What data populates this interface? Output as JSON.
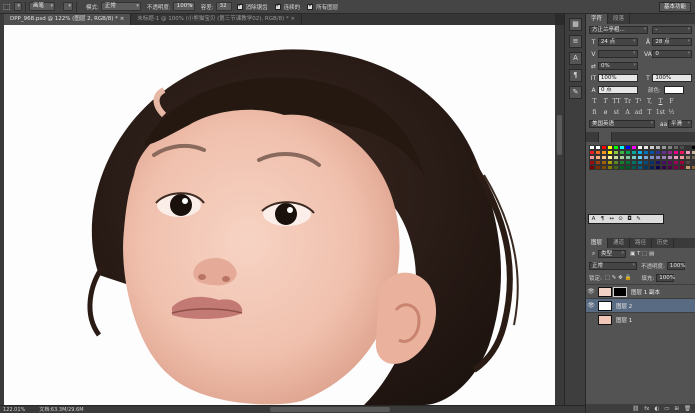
{
  "options_bar": {
    "tool_icon": "marquee-icon",
    "blend_mode_label": "模式:",
    "brush_dropdown": "画笔",
    "mode_value": "正常",
    "opacity_label": "不透明度:",
    "opacity_value": "100%",
    "tolerance_label": "容差:",
    "tolerance_value": "32",
    "anti_alias_label": "消除锯齿",
    "contiguous_label": "连续的",
    "all_layers_label": "所有图层",
    "workspace_button": "基本功能"
  },
  "tabs": [
    {
      "label": "DPP_968.psd @ 122% (图层 2, RGB/8) *",
      "active": true
    },
    {
      "label": "未标题-1 @ 100% (小熊猫宝贝 (第三节课教学02), RGB/8) *",
      "active": false
    }
  ],
  "status": {
    "zoom": "122.01%",
    "doc_size": "文档:63.3M/29.6M"
  },
  "character_panel": {
    "tabs": [
      "字符",
      "段落"
    ],
    "font_family": "方正兰亭粗...",
    "font_style": "-",
    "font_size": "24 点",
    "leading": "28 点",
    "kerning": "",
    "tracking": "0",
    "tsume": "0%",
    "vertical_scale": "100%",
    "horizontal_scale": "100%",
    "baseline_shift": "0 点",
    "color_label": "颜色:",
    "language": "美国英语",
    "antialias": "平滑"
  },
  "type_glyphs": [
    "T",
    "T",
    "TT",
    "Tr",
    "T¹",
    "T,",
    "T",
    "F"
  ],
  "ot_glyphs": [
    "fi",
    "ø",
    "st",
    "A",
    "ad",
    "T",
    "1st",
    "½"
  ],
  "swatch_colors": [
    "#ffffff",
    "#ffffff",
    "#ff0000",
    "#ffff00",
    "#00ff00",
    "#00ffff",
    "#0000ff",
    "#ff00ff",
    "#ffffff",
    "#e6e6e6",
    "#cccccc",
    "#b3b3b3",
    "#999999",
    "#808080",
    "#666666",
    "#4d4d4d",
    "#333333",
    "#000000",
    "#ed1c24",
    "#f26522",
    "#f7941d",
    "#fff200",
    "#8dc63f",
    "#39b54a",
    "#00a651",
    "#00a99d",
    "#00aeef",
    "#0072bc",
    "#0054a6",
    "#2e3192",
    "#662d91",
    "#92278f",
    "#ec008c",
    "#ed145b",
    "#f49ac2",
    "#c7b299",
    "#f6989d",
    "#f9ad81",
    "#fdc68a",
    "#fff79a",
    "#c4df9b",
    "#a3d39c",
    "#82ca9d",
    "#7accc8",
    "#6dcff6",
    "#7da7d9",
    "#8393ca",
    "#8781bd",
    "#a186be",
    "#bd8cbf",
    "#f49ac1",
    "#f5989d",
    "#998675",
    "#736357",
    "#9e0b0f",
    "#a0410d",
    "#a36209",
    "#aba000",
    "#598527",
    "#1a7b30",
    "#007236",
    "#00746b",
    "#0076a3",
    "#004b80",
    "#003471",
    "#1b1464",
    "#440e62",
    "#630460",
    "#9e005d",
    "#9e0039",
    "#534741",
    "#362f2d",
    "#790000",
    "#7b2e00",
    "#7d4900",
    "#827b00",
    "#406618",
    "#005e20",
    "#005826",
    "#005952",
    "#005b7f",
    "#003663",
    "#002157",
    "#0d004c",
    "#32004b",
    "#4b0049",
    "#7b0046",
    "#7a0026",
    "#c69c6d",
    "#8c6239"
  ],
  "tool_strip": [
    "A-icon",
    "paragraph-icon",
    "move-icon",
    "wand-icon",
    "camera-icon",
    "wrench-icon"
  ],
  "layers_panel": {
    "tabs": [
      "图层",
      "通道",
      "路径",
      "历史"
    ],
    "filter_label": "类型",
    "blend_mode": "正常",
    "opacity_label": "不透明度:",
    "opacity_value": "100%",
    "lock_label": "锁定:",
    "fill_label": "填充:",
    "fill_value": "100%",
    "layers": [
      {
        "name": "图层 1 副本",
        "visible": true,
        "has_mask": true,
        "selected": false
      },
      {
        "name": "图层 2",
        "visible": true,
        "has_mask": false,
        "selected": true
      },
      {
        "name": "图层 1",
        "visible": false,
        "has_mask": false,
        "selected": false
      }
    ]
  }
}
